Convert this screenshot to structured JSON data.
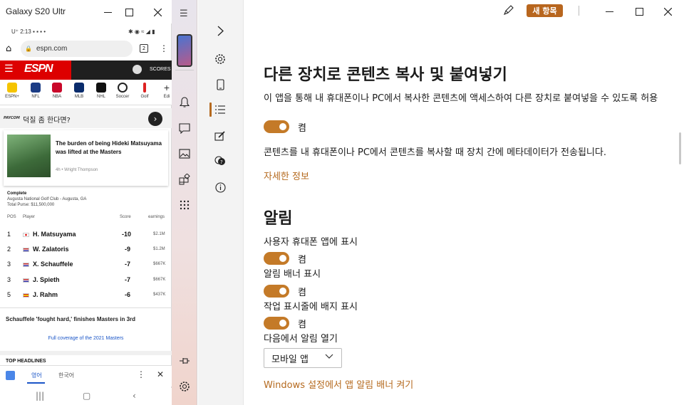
{
  "phone_window": {
    "title": "Galaxy S20 Ultr",
    "status_time": "U⁺ 2:13 ▪ ▪ ▪ •",
    "status_right": "✱ ◉ ≈ ◢ ▮",
    "url": "espn.com",
    "tab_count": "2",
    "espn_logo": "ESPN",
    "scores_label": "SCORES",
    "leagues": [
      "ESPN+",
      "NFL",
      "NBA",
      "MLB",
      "NHL",
      "Soccer",
      "Golf",
      "Edi"
    ],
    "ad_brand": "PAYCOM",
    "ad_text": "덕질 좀 한다면?",
    "story_title": "The burden of being Hideki Matsuyama was lifted at the Masters",
    "story_meta": "4h • Wright Thompson",
    "tournament_status": "Complete",
    "tournament_venue": "Augusta National Golf Club - Augusta, GA",
    "tournament_purse": "Total Purse: $11,500,000",
    "leaderboard_headers": {
      "pos": "POS",
      "player": "Player",
      "score": "Score",
      "earnings": "earnings"
    },
    "leaderboard": [
      {
        "pos": "1",
        "player": "H. Matsuyama",
        "score": "-10",
        "earnings": "$2.1M"
      },
      {
        "pos": "2",
        "player": "W. Zalatoris",
        "score": "-9",
        "earnings": "$1.2M"
      },
      {
        "pos": "3",
        "player": "X. Schauffele",
        "score": "-7",
        "earnings": "$667K"
      },
      {
        "pos": "3",
        "player": "J. Spieth",
        "score": "-7",
        "earnings": "$667K"
      },
      {
        "pos": "5",
        "player": "J. Rahm",
        "score": "-6",
        "earnings": "$437K"
      }
    ],
    "headline_item": "Schauffele 'fought hard,' finishes Masters in 3rd",
    "coverage_link": "Full coverage of the 2021 Masters",
    "top_headlines": "TOP HEADLINES",
    "translate_from": "영어",
    "translate_to": "한국어"
  },
  "app": {
    "new_item_button": "새 항목",
    "section1": {
      "title": "다른 장치로 콘텐츠 복사 및 붙여넣기",
      "description": "이 앱을 통해 내 휴대폰이나 PC에서 복사한 콘텐츠에 액세스하여 다른 장치로 붙여넣을 수 있도록 허용",
      "toggle_label": "켬",
      "note": "콘텐츠를 내 휴대폰이나 PC에서 콘텐츠를 복사할 때 장치 간에 메타데이터가 전송됩니다.",
      "more_info": "자세한 정보"
    },
    "section2": {
      "title": "알림",
      "setting1": "사용자 휴대폰 앱에 표시",
      "setting1_state": "켬",
      "setting2": "알림 배너 표시",
      "setting2_state": "켬",
      "setting3": "작업 표시줄에 배지 표시",
      "setting3_state": "켬",
      "open_from_label": "다음에서 알림 열기",
      "open_from_value": "모바일 앱",
      "windows_link": "Windows 설정에서 앱 알림 배너 켜기"
    }
  },
  "colors": {
    "accent": "#c47a28",
    "espn_red": "#dd0000",
    "link": "#b56a1f"
  }
}
